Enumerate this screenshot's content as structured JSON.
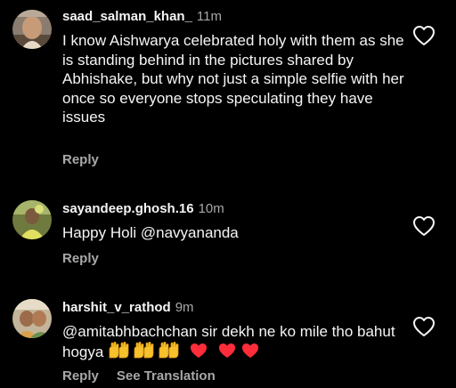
{
  "comments": [
    {
      "username": "saad_salman_khan_",
      "time": "11m",
      "text": "I know Aishwarya celebrated holy with them as she is standing behind in the pictures shared by Abhishake, but why not just a simple selfie with her once so everyone stops speculating they have issues",
      "reply_label": "Reply"
    },
    {
      "username": "sayandeep.ghosh.16",
      "time": "10m",
      "text": "Happy Holi @navyananda",
      "reply_label": "Reply"
    },
    {
      "username": "harshit_v_rathod",
      "time": "9m",
      "mention": "@amitabhbachchan",
      "text": " sir dekh ne ko mile tho bahut hogya",
      "reply_label": "Reply",
      "translate_label": "See Translation"
    }
  ],
  "icons": {
    "like": "heart-outline-icon",
    "raised_hands": "raising-hands-emoji",
    "red_heart": "red-heart-emoji"
  },
  "colors": {
    "background": "#000000",
    "primary_text": "#f5f5f5",
    "secondary_text": "#a8a8a8",
    "heart_red": "#ff2d3a"
  }
}
